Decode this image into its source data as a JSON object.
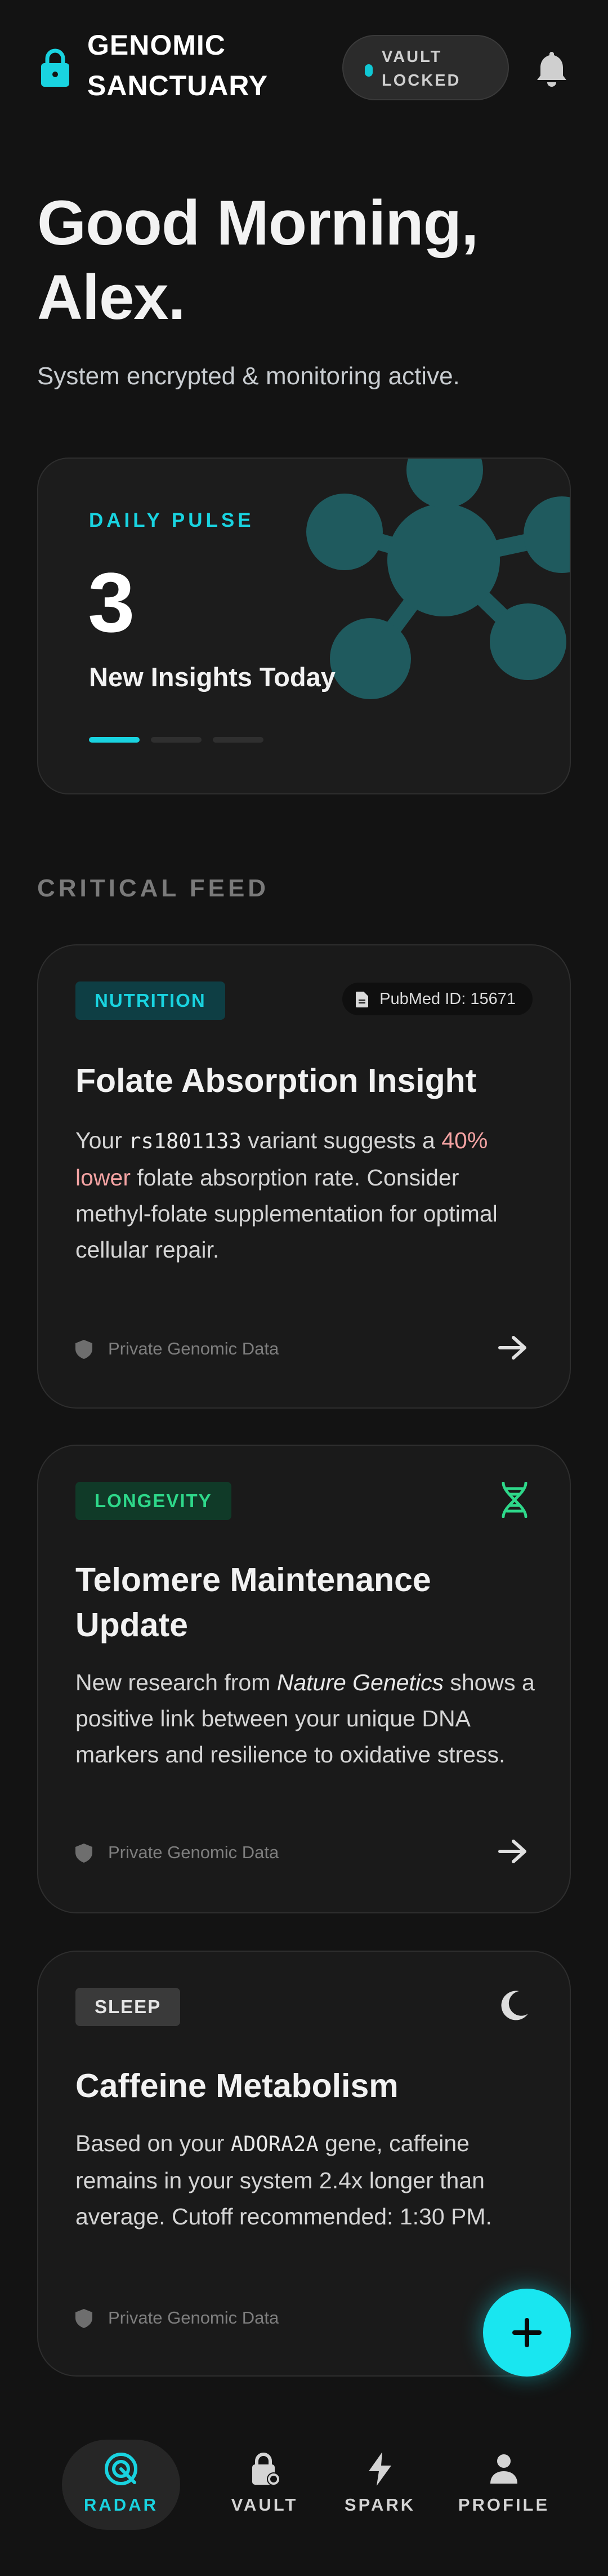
{
  "header": {
    "app_title": "GENOMIC SANCTUARY",
    "vault_status": "VAULT LOCKED"
  },
  "greeting": {
    "title": "Good Morning, Alex.",
    "subtitle": "System encrypted & monitoring active."
  },
  "daily_pulse": {
    "label": "DAILY PULSE",
    "value": "3",
    "caption": "New Insights Today",
    "page_count": 3,
    "active_page": 1
  },
  "feed": {
    "section_label": "CRITICAL FEED",
    "cards": [
      {
        "tag": "NUTRITION",
        "source": "PubMed ID: 15671",
        "title": "Folate Absorption Insight",
        "body_prefix": "Your ",
        "body_code": "rs1801133",
        "body_mid": " variant suggests a ",
        "body_highlight": "40% lower",
        "body_suffix": " folate absorption rate. Consider methyl-folate supplementation for optimal cellular repair.",
        "footer": "Private Genomic Data"
      },
      {
        "tag": "LONGEVITY",
        "icon": "dna-icon",
        "title": "Telomere Maintenance Update",
        "body_prefix": "New research from ",
        "body_em": "Nature Genetics",
        "body_suffix": " shows a positive link between your unique DNA markers and resilience to oxidative stress.",
        "footer": "Private Genomic Data"
      },
      {
        "tag": "SLEEP",
        "icon": "moon-icon",
        "title": "Caffeine Metabolism",
        "body_prefix": "Based on your ",
        "body_code": "ADORA2A",
        "body_suffix": " gene, caffeine remains in your system 2.4x longer than average. Cutoff recommended: 1:30 PM.",
        "footer": "Private Genomic Data"
      }
    ]
  },
  "nav": {
    "items": [
      {
        "label": "RADAR",
        "icon": "radar-icon",
        "active": true
      },
      {
        "label": "VAULT",
        "icon": "vault-icon",
        "active": false
      },
      {
        "label": "SPARK",
        "icon": "bolt-icon",
        "active": false
      },
      {
        "label": "PROFILE",
        "icon": "person-icon",
        "active": false
      }
    ]
  },
  "colors": {
    "accent": "#19D3E0",
    "background": "#131313",
    "card": "#1A1A1A",
    "highlight": "#F4A3A3",
    "longevity": "#2ED88A"
  }
}
